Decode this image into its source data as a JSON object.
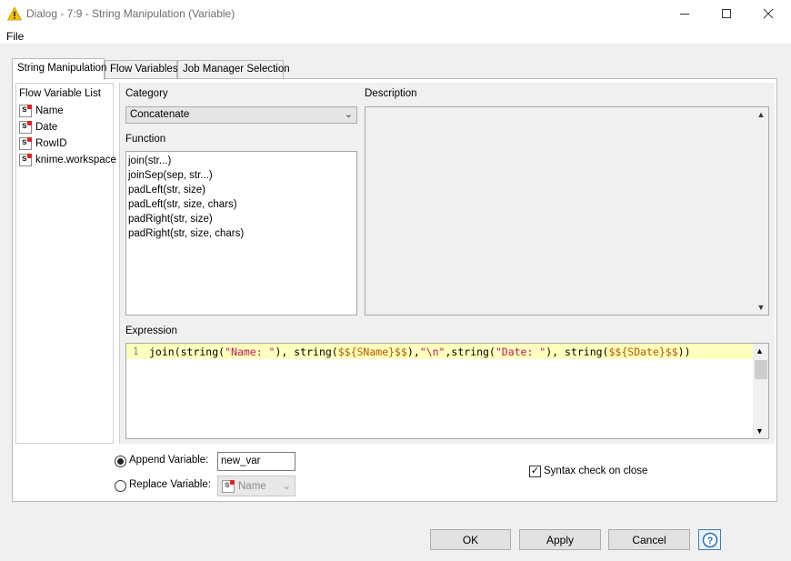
{
  "window": {
    "title": "Dialog - 7:9 - String Manipulation (Variable)",
    "menu": [
      "File"
    ]
  },
  "tabs": [
    {
      "label": "String Manipulation",
      "active": true
    },
    {
      "label": "Flow Variables",
      "active": false
    },
    {
      "label": "Job Manager Selection",
      "active": false
    }
  ],
  "flow_variable_list": {
    "title": "Flow Variable List",
    "items": [
      {
        "label": "Name",
        "icon": "string-variable-icon"
      },
      {
        "label": "Date",
        "icon": "string-variable-icon"
      },
      {
        "label": "RowID",
        "icon": "string-variable-icon"
      },
      {
        "label": "knime.workspace",
        "icon": "string-variable-icon"
      }
    ]
  },
  "category": {
    "label": "Category",
    "selected": "Concatenate"
  },
  "function": {
    "label": "Function",
    "items": [
      "join(str...)",
      "joinSep(sep, str...)",
      "padLeft(str, size)",
      "padLeft(str, size, chars)",
      "padRight(str, size)",
      "padRight(str, size, chars)"
    ]
  },
  "description": {
    "label": "Description",
    "text": ""
  },
  "expression": {
    "label": "Expression",
    "line_number": "1",
    "code": "join(string(\"Name: \"), string($${SName}$$),\"\\n\",string(\"Date: \"), string($${SDate}$$))"
  },
  "output": {
    "append_label": "Append Variable:",
    "append_value": "new_var",
    "replace_label": "Replace Variable:",
    "replace_value": "Name",
    "mode": "append"
  },
  "syntax_check": {
    "label": "Syntax check on close",
    "checked": true
  },
  "buttons": {
    "ok": "OK",
    "apply": "Apply",
    "cancel": "Cancel",
    "help_icon": "help-icon"
  },
  "colors": {
    "expression_highlight": "#ffffbe",
    "string_literal": "#c2185b",
    "variable_literal": "#b35900"
  }
}
